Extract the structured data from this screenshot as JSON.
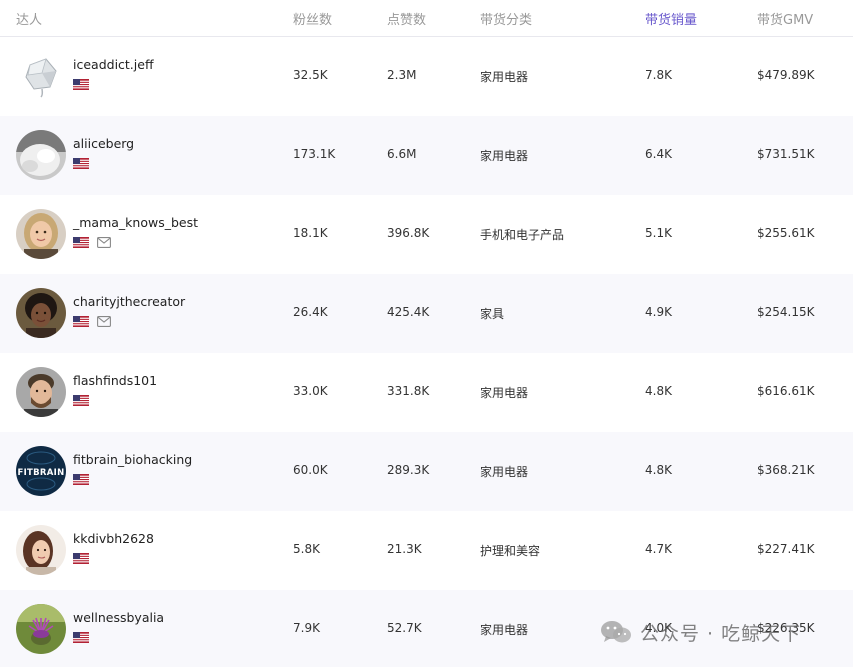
{
  "columns": [
    "达人",
    "粉丝数",
    "点赞数",
    "带货分类",
    "带货销量",
    "带货GMV"
  ],
  "sorted_column": "带货销量",
  "accent_color": "#6a5acd",
  "rows": [
    {
      "name": "iceaddict.jeff",
      "fans": "32.5K",
      "likes": "2.3M",
      "category": "家用电器",
      "sales": "7.8K",
      "gmv": "$479.89K",
      "avatar": "ice-cube",
      "country_flag": "us-flag-icon",
      "has_mail": false
    },
    {
      "name": "aliiceberg",
      "fans": "173.1K",
      "likes": "6.6M",
      "category": "家用电器",
      "sales": "6.4K",
      "gmv": "$731.51K",
      "avatar": "ice-white",
      "country_flag": "us-flag-icon",
      "has_mail": false
    },
    {
      "name": "_mama_knows_best",
      "fans": "18.1K",
      "likes": "396.8K",
      "category": "手机和电子产品",
      "sales": "5.1K",
      "gmv": "$255.61K",
      "avatar": "woman-blonde",
      "country_flag": "us-flag-icon",
      "has_mail": true
    },
    {
      "name": "charityjthecreator",
      "fans": "26.4K",
      "likes": "425.4K",
      "category": "家具",
      "sales": "4.9K",
      "gmv": "$254.15K",
      "avatar": "woman-dark",
      "country_flag": "us-flag-icon",
      "has_mail": true
    },
    {
      "name": "flashfinds101",
      "fans": "33.0K",
      "likes": "331.8K",
      "category": "家用电器",
      "sales": "4.8K",
      "gmv": "$616.61K",
      "avatar": "man-beard",
      "country_flag": "us-flag-icon",
      "has_mail": false
    },
    {
      "name": "fitbrain_biohacking",
      "fans": "60.0K",
      "likes": "289.3K",
      "category": "家用电器",
      "sales": "4.8K",
      "gmv": "$368.21K",
      "avatar": "fitbrain-logo",
      "country_flag": "us-flag-icon",
      "has_mail": false
    },
    {
      "name": "kkdivbh2628",
      "fans": "5.8K",
      "likes": "21.3K",
      "category": "护理和美容",
      "sales": "4.7K",
      "gmv": "$227.41K",
      "avatar": "woman-brunette",
      "country_flag": "us-flag-icon",
      "has_mail": false
    },
    {
      "name": "wellnessbyalia",
      "fans": "7.9K",
      "likes": "52.7K",
      "category": "家用电器",
      "sales": "4.0K",
      "gmv": "$226.35K",
      "avatar": "thistle-flower",
      "country_flag": "us-flag-icon",
      "has_mail": false
    }
  ],
  "watermark": {
    "text": "公众号 · 吃鲸天下",
    "icon": "wechat-icon"
  }
}
